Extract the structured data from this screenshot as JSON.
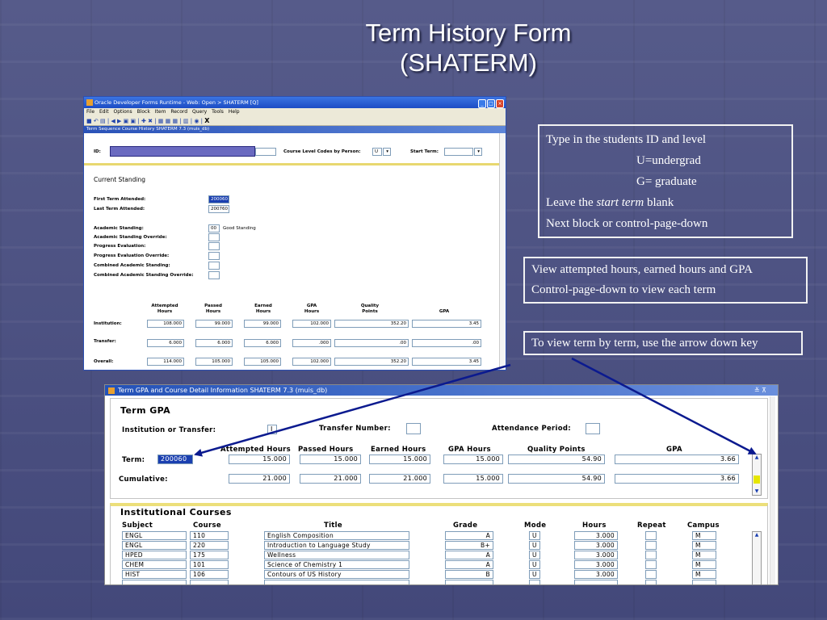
{
  "slide": {
    "title_line1": "Term History Form",
    "title_line2": "(SHATERM)",
    "colors": {
      "background": "#4a4f7e",
      "note_border": "#f2f2f2",
      "arrow": "#0b1a8f"
    }
  },
  "notes": {
    "box1": {
      "line1": "Type in the students ID and level",
      "line2": "U=undergrad",
      "line3": "G= graduate",
      "line4_a": "Leave the ",
      "line4_em": "start term",
      "line4_b": " blank",
      "line5": "Next block or control-page-down"
    },
    "box2": {
      "line1": "View attempted hours, earned hours and GPA",
      "line2": "Control-page-down to view each term"
    },
    "box3": {
      "line1": "To view term by term, use the arrow down key"
    }
  },
  "window1": {
    "title": "Oracle Developer Forms Runtime - Web:  Open > SHATERM [Q]",
    "menu": [
      "File",
      "Edit",
      "Options",
      "Block",
      "Item",
      "Record",
      "Query",
      "Tools",
      "Help"
    ],
    "toolbar_x": "X",
    "subtitle": "Term Sequence Course History  SHATERM  7.3  (muis_db)",
    "key": {
      "id_label": "ID:",
      "level_label": "Course Level Codes by Person:",
      "level_value": "U",
      "start_term_label": "Start Term:"
    },
    "current_standing": {
      "section_title": "Current Standing",
      "first_term_label": "First Term Attended:",
      "first_term_value": "200060",
      "last_term_label": "Last Term Attended:",
      "last_term_value": "200760",
      "academic_standing_label": "Academic Standing:",
      "academic_standing_code": "00",
      "academic_standing_desc": "Good Standing",
      "academic_standing_override_label": "Academic Standing Override:",
      "progress_eval_label": "Progress Evaluation:",
      "progress_eval_override_label": "Progress Evaluation Override:",
      "combined_standing_label": "Combined Academic Standing:",
      "combined_standing_override_label": "Combined Academic Standing Override:"
    },
    "columns": {
      "attempted_1": "Attempted",
      "attempted_2": "Hours",
      "passed_1": "Passed",
      "passed_2": "Hours",
      "earned_1": "Earned",
      "earned_2": "Hours",
      "gpa_hours_1": "GPA",
      "gpa_hours_2": "Hours",
      "quality_1": "Quality",
      "quality_2": "Points",
      "gpa": "GPA"
    },
    "rows": [
      {
        "label": "Institution:",
        "attempted": "108.000",
        "passed": "99.000",
        "earned": "99.000",
        "gpa_hours": "102.000",
        "quality": "352.20",
        "gpa": "3.45"
      },
      {
        "label": "Transfer:",
        "attempted": "6.000",
        "passed": "6.000",
        "earned": "6.000",
        "gpa_hours": ".000",
        "quality": ".00",
        "gpa": ".00"
      },
      {
        "label": "Overall:",
        "attempted": "114.000",
        "passed": "105.000",
        "earned": "105.000",
        "gpa_hours": "102.000",
        "quality": "352.20",
        "gpa": "3.45"
      }
    ]
  },
  "window2": {
    "title": "Term GPA and Course Detail Information   SHATERM  7.3  (muis_db)",
    "title_controls": "≚ ⊼",
    "term_gpa": {
      "section_title": "Term GPA",
      "inst_or_transfer_label": "Institution or Transfer:",
      "inst_or_transfer_value": "I",
      "transfer_number_label": "Transfer Number:",
      "attendance_period_label": "Attendance Period:",
      "headers": {
        "attempted": "Attempted Hours",
        "passed": "Passed Hours",
        "earned": "Earned Hours",
        "gpa_hours": "GPA Hours",
        "quality": "Quality Points",
        "gpa": "GPA"
      },
      "term_label": "Term:",
      "term_value": "200060",
      "term_row": {
        "attempted": "15.000",
        "passed": "15.000",
        "earned": "15.000",
        "gpa_hours": "15.000",
        "quality": "54.90",
        "gpa": "3.66"
      },
      "cumulative_label": "Cumulative:",
      "cumulative_row": {
        "attempted": "21.000",
        "passed": "21.000",
        "earned": "21.000",
        "gpa_hours": "15.000",
        "quality": "54.90",
        "gpa": "3.66"
      }
    },
    "courses": {
      "section_title": "Institutional Courses",
      "headers": {
        "subject": "Subject",
        "course": "Course",
        "title": "Title",
        "grade": "Grade",
        "mode": "Mode",
        "hours": "Hours",
        "repeat": "Repeat",
        "campus": "Campus"
      },
      "rows": [
        {
          "subject": "ENGL",
          "course": "110",
          "title": "English Composition",
          "grade": "A",
          "mode": "U",
          "hours": "3.000",
          "campus": "M"
        },
        {
          "subject": "ENGL",
          "course": "220",
          "title": "Introduction to Language Study",
          "grade": "B+",
          "mode": "U",
          "hours": "3.000",
          "campus": "M"
        },
        {
          "subject": "HPED",
          "course": "175",
          "title": "Wellness",
          "grade": "A",
          "mode": "U",
          "hours": "3.000",
          "campus": "M"
        },
        {
          "subject": "CHEM",
          "course": "101",
          "title": "Science of Chemistry 1",
          "grade": "A",
          "mode": "U",
          "hours": "3.000",
          "campus": "M"
        },
        {
          "subject": "HIST",
          "course": "106",
          "title": "Contours of US History",
          "grade": "B",
          "mode": "U",
          "hours": "3.000",
          "campus": "M"
        }
      ]
    }
  }
}
